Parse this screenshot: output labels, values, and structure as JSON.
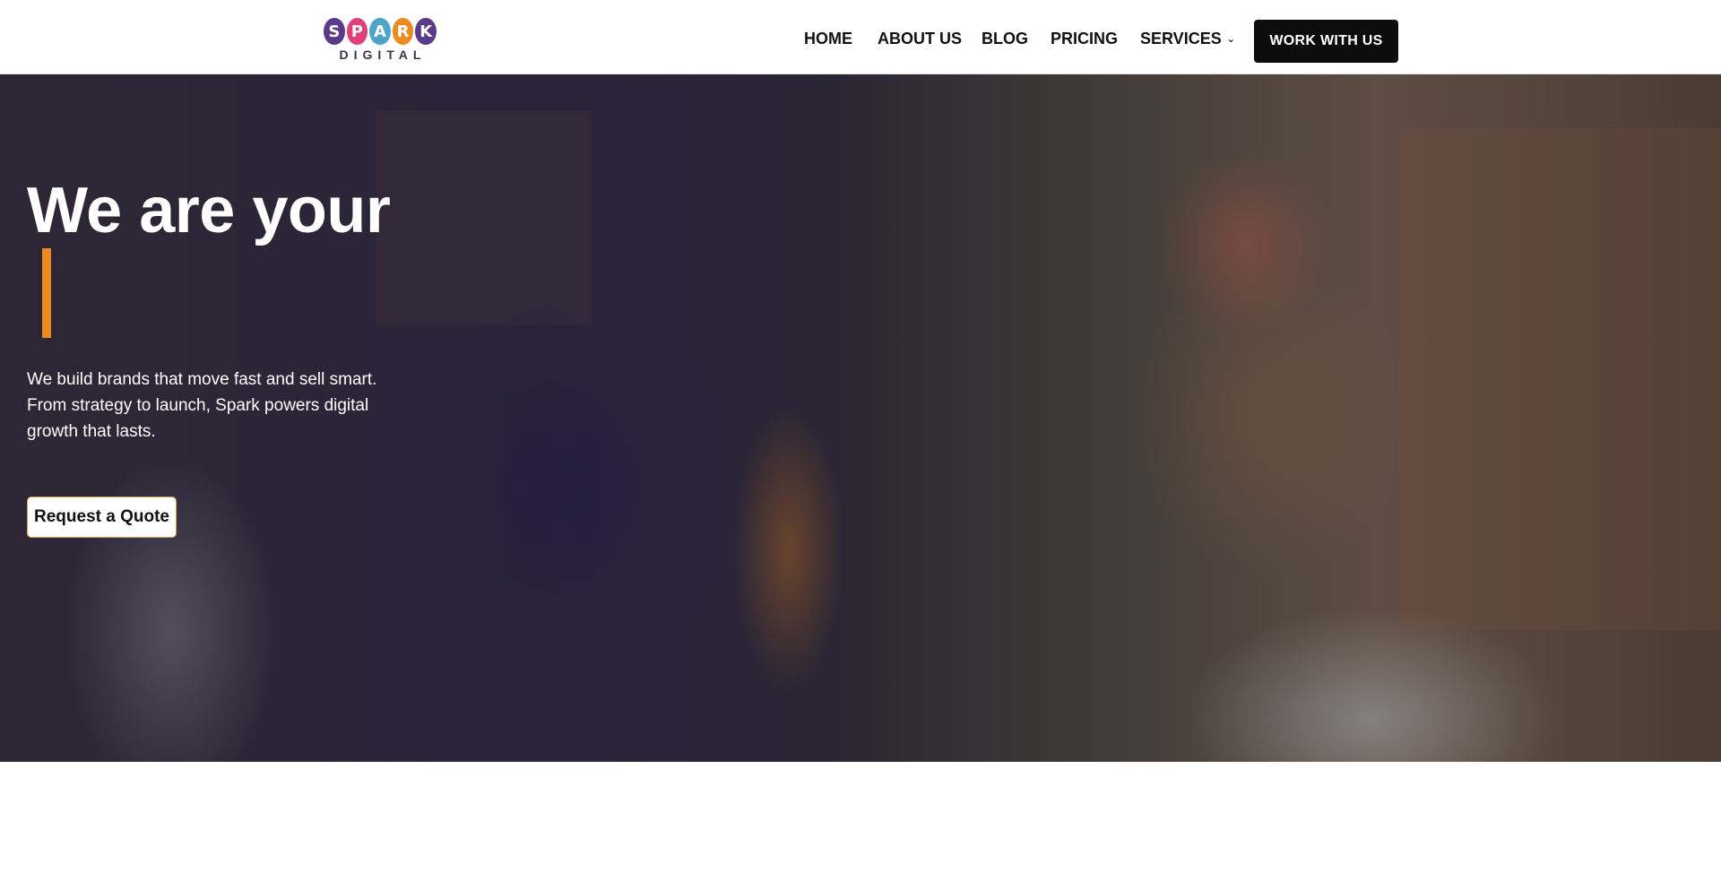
{
  "brand": {
    "logo_letters": [
      "S",
      "P",
      "A",
      "R",
      "K"
    ],
    "logo_colors": [
      "#5b3a8c",
      "#e0407a",
      "#4ea3c8",
      "#ec8a1f",
      "#5b3a8c"
    ],
    "logo_subtitle": "DIGITAL"
  },
  "nav": {
    "items": [
      {
        "label": "HOME"
      },
      {
        "label": "ABOUT US"
      },
      {
        "label": "BLOG"
      },
      {
        "label": "PRICING"
      },
      {
        "label": "SERVICES",
        "has_dropdown": true
      }
    ],
    "cta_label": "WORK WITH US"
  },
  "hero": {
    "title": "We are your",
    "description": "We build brands that move fast and sell smart. From strategy to launch, Spark powers digital growth that lasts.",
    "quote_button": "Request a Quote",
    "accent_color": "#ec8a1f"
  }
}
